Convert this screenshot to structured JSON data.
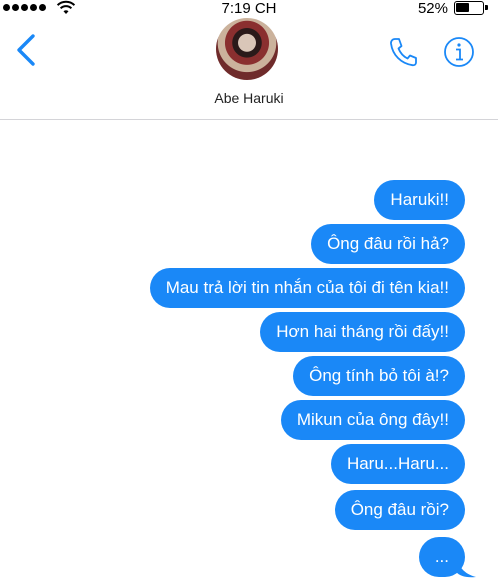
{
  "status_bar": {
    "time": "7:19 CH",
    "battery_percent": "52%",
    "battery_level": 0.52
  },
  "header": {
    "contact_name": "Abe Haruki"
  },
  "messages": [
    {
      "text": "Haruki!!"
    },
    {
      "text": "Ông đâu rồi hả?"
    },
    {
      "text": "Mau trả lời tin nhắn của tôi đi tên kia!!"
    },
    {
      "text": "Hơn hai tháng rồi đấy!!"
    },
    {
      "text": "Ông tính bỏ tôi à!?"
    },
    {
      "text": "Mikun của ông đây!!"
    },
    {
      "text": "Haru...Haru..."
    },
    {
      "text": "Ông đâu rồi?"
    },
    {
      "text": "..."
    }
  ],
  "colors": {
    "accent": "#1a88f7",
    "bubble_text": "#ffffff"
  },
  "icons": {
    "back": "chevron-left-icon",
    "call": "phone-icon",
    "info": "info-icon"
  }
}
